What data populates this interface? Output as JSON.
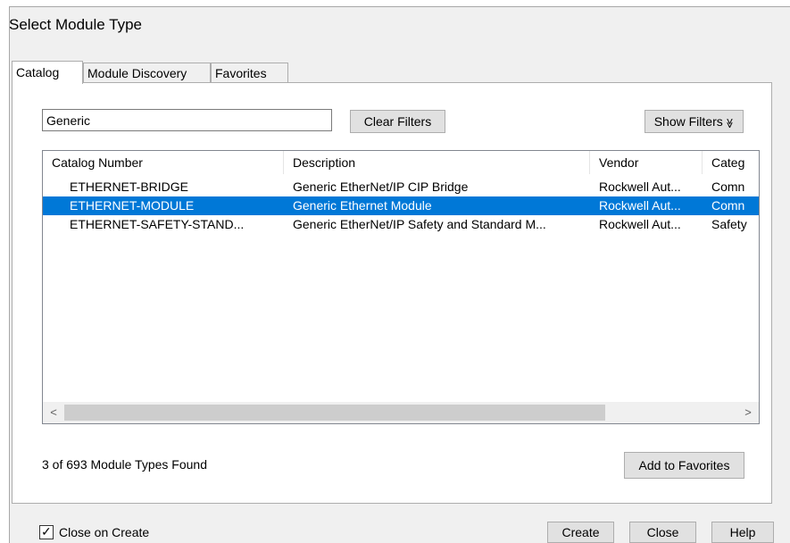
{
  "dialog": {
    "title": "Select Module Type"
  },
  "tabs": [
    {
      "label": "Catalog"
    },
    {
      "label": "Module Discovery"
    },
    {
      "label": "Favorites"
    }
  ],
  "search": {
    "value": "Generic"
  },
  "buttons": {
    "clear_filters": "Clear Filters",
    "show_filters": "Show Filters",
    "show_filters_icon": "≫",
    "add_to_favorites": "Add to Favorites",
    "create": "Create",
    "close": "Close",
    "help": "Help"
  },
  "table": {
    "columns": [
      "Catalog Number",
      "Description",
      "Vendor",
      "Categ"
    ],
    "rows": [
      [
        "ETHERNET-BRIDGE",
        "Generic EtherNet/IP CIP Bridge",
        "Rockwell Aut...",
        "Comn"
      ],
      [
        "ETHERNET-MODULE",
        "Generic Ethernet Module",
        "Rockwell Aut...",
        "Comn"
      ],
      [
        "ETHERNET-SAFETY-STAND...",
        "Generic EtherNet/IP Safety and Standard M...",
        "Rockwell Aut...",
        "Safety"
      ]
    ],
    "selected_row": 1
  },
  "scroll": {
    "left_arrow": "<",
    "right_arrow": ">"
  },
  "status": "3 of 693 Module Types Found",
  "close_on_create": {
    "label": "Close on Create",
    "checked": true,
    "check_glyph": "✓"
  },
  "colors": {
    "selection": "#0078d7",
    "dialog_bg": "#f0f0f0"
  }
}
